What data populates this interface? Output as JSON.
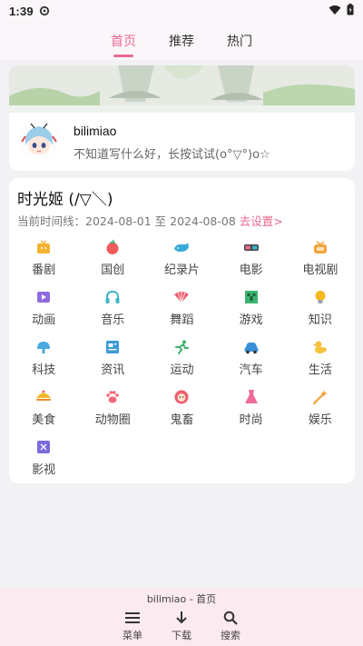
{
  "status_bar": {
    "time": "1:39"
  },
  "tabs": [
    {
      "label": "首页",
      "active": true
    },
    {
      "label": "推荐",
      "active": false
    },
    {
      "label": "热门",
      "active": false
    }
  ],
  "profile": {
    "username": "bilimiao",
    "signature": "不知道写什么好，长按试试(o°▽°)o☆"
  },
  "time_machine": {
    "title": "时光姬 (/▽＼)",
    "timeline_prefix": "当前时间线：",
    "start_date": "2024-08-01",
    "sep": "至",
    "end_date": "2024-08-08",
    "settings_link": "去设置>",
    "categories": [
      {
        "label": "番剧",
        "icon": "tv-icon",
        "color": "#f6b233"
      },
      {
        "label": "国创",
        "icon": "tomato-icon",
        "color": "#ef5b5b"
      },
      {
        "label": "纪录片",
        "icon": "whale-icon",
        "color": "#38a9d8"
      },
      {
        "label": "电影",
        "icon": "3d-glasses-icon",
        "color": "#ef6b8a"
      },
      {
        "label": "电视剧",
        "icon": "tv-set-icon",
        "color": "#f4a13b"
      },
      {
        "label": "动画",
        "icon": "play-icon",
        "color": "#8e6bdd"
      },
      {
        "label": "音乐",
        "icon": "headphones-icon",
        "color": "#3db6c9"
      },
      {
        "label": "舞蹈",
        "icon": "fan-icon",
        "color": "#ef5b6b"
      },
      {
        "label": "游戏",
        "icon": "creeper-icon",
        "color": "#3cb371"
      },
      {
        "label": "知识",
        "icon": "lightbulb-icon",
        "color": "#f4b820"
      },
      {
        "label": "科技",
        "icon": "dome-icon",
        "color": "#4aa9e0"
      },
      {
        "label": "资讯",
        "icon": "newspaper-icon",
        "color": "#3a9bd9"
      },
      {
        "label": "运动",
        "icon": "runner-icon",
        "color": "#3cb371"
      },
      {
        "label": "汽车",
        "icon": "car-icon",
        "color": "#3b8fd9"
      },
      {
        "label": "生活",
        "icon": "duck-icon",
        "color": "#f6c23c"
      },
      {
        "label": "美食",
        "icon": "food-icon",
        "color": "#f5b828"
      },
      {
        "label": "动物圈",
        "icon": "paw-icon",
        "color": "#ef6b7a"
      },
      {
        "label": "鬼畜",
        "icon": "lion-icon",
        "color": "#ef5b6b"
      },
      {
        "label": "时尚",
        "icon": "dress-icon",
        "color": "#ef6b9a"
      },
      {
        "label": "娱乐",
        "icon": "wand-icon",
        "color": "#f4a13b"
      },
      {
        "label": "影视",
        "icon": "film-icon",
        "color": "#7a6bdd"
      }
    ]
  },
  "bottom_bar": {
    "title": "bilimiao - 首页",
    "actions": [
      {
        "label": "菜单",
        "icon": "menu-icon"
      },
      {
        "label": "下载",
        "icon": "download-icon"
      },
      {
        "label": "搜索",
        "icon": "search-icon"
      }
    ]
  },
  "colors": {
    "accent": "#e9698f",
    "bottom_bg": "#fbeaf0",
    "top_bg": "#fbf6f9"
  }
}
